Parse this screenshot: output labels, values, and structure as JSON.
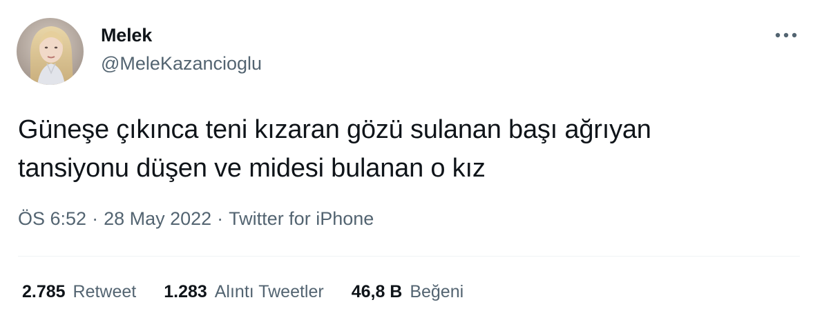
{
  "author": {
    "name": "Melek",
    "handle": "@MeleKazancioglu",
    "avatar_icon": "profile-photo"
  },
  "more_icon": "more-options-icon",
  "tweet": {
    "lines": [
      "Güneşe çıkınca teni kızaran gözü sulanan başı ağrıyan",
      "tansiyonu düşen ve midesi bulanan o kız"
    ]
  },
  "meta": {
    "time": "ÖS 6:52",
    "separator": "·",
    "date": "28 May 2022",
    "source": "Twitter for iPhone"
  },
  "stats": {
    "retweets": {
      "count": "2.785",
      "label": "Retweet"
    },
    "quotes": {
      "count": "1.283",
      "label": "Alıntı Tweetler"
    },
    "likes": {
      "count": "46,8 B",
      "label": "Beğeni"
    }
  },
  "colors": {
    "text_primary": "#0f1419",
    "text_secondary": "#536471",
    "divider": "#eff3f4"
  }
}
